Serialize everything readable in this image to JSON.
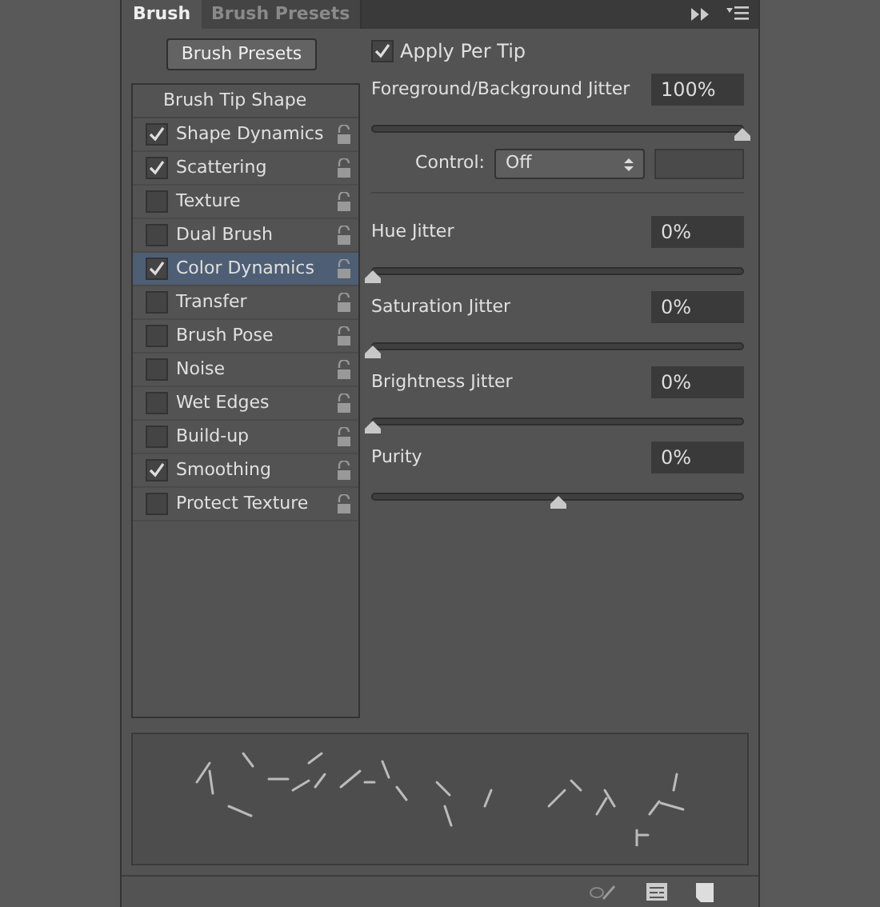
{
  "tabs": [
    {
      "label": "Brush",
      "selected": true
    },
    {
      "label": "Brush Presets",
      "selected": false
    }
  ],
  "presets_button": "Brush Presets",
  "sidebar": {
    "header": "Brush Tip Shape",
    "items": [
      {
        "label": "Shape Dynamics",
        "checked": true,
        "selected": false
      },
      {
        "label": "Scattering",
        "checked": true,
        "selected": false
      },
      {
        "label": "Texture",
        "checked": false,
        "selected": false
      },
      {
        "label": "Dual Brush",
        "checked": false,
        "selected": false
      },
      {
        "label": "Color Dynamics",
        "checked": true,
        "selected": true
      },
      {
        "label": "Transfer",
        "checked": false,
        "selected": false
      },
      {
        "label": "Brush Pose",
        "checked": false,
        "selected": false
      },
      {
        "label": "Noise",
        "checked": false,
        "selected": false
      },
      {
        "label": "Wet Edges",
        "checked": false,
        "selected": false
      },
      {
        "label": "Build-up",
        "checked": false,
        "selected": false
      },
      {
        "label": "Smoothing",
        "checked": true,
        "selected": false
      },
      {
        "label": "Protect Texture",
        "checked": false,
        "selected": false
      }
    ]
  },
  "apply_per_tip": {
    "label": "Apply Per Tip",
    "checked": true
  },
  "foreground_jitter": {
    "label": "Foreground/Background Jitter",
    "value": "100%",
    "level": 1
  },
  "control": {
    "label": "Control:",
    "value": "Off"
  },
  "sliders": [
    {
      "label": "Hue Jitter",
      "value": "0%",
      "level": 0
    },
    {
      "label": "Saturation Jitter",
      "value": "0%",
      "level": 0
    },
    {
      "label": "Brightness Jitter",
      "value": "0%",
      "level": 0
    },
    {
      "label": "Purity",
      "value": "0%",
      "level": 0.5
    }
  ]
}
